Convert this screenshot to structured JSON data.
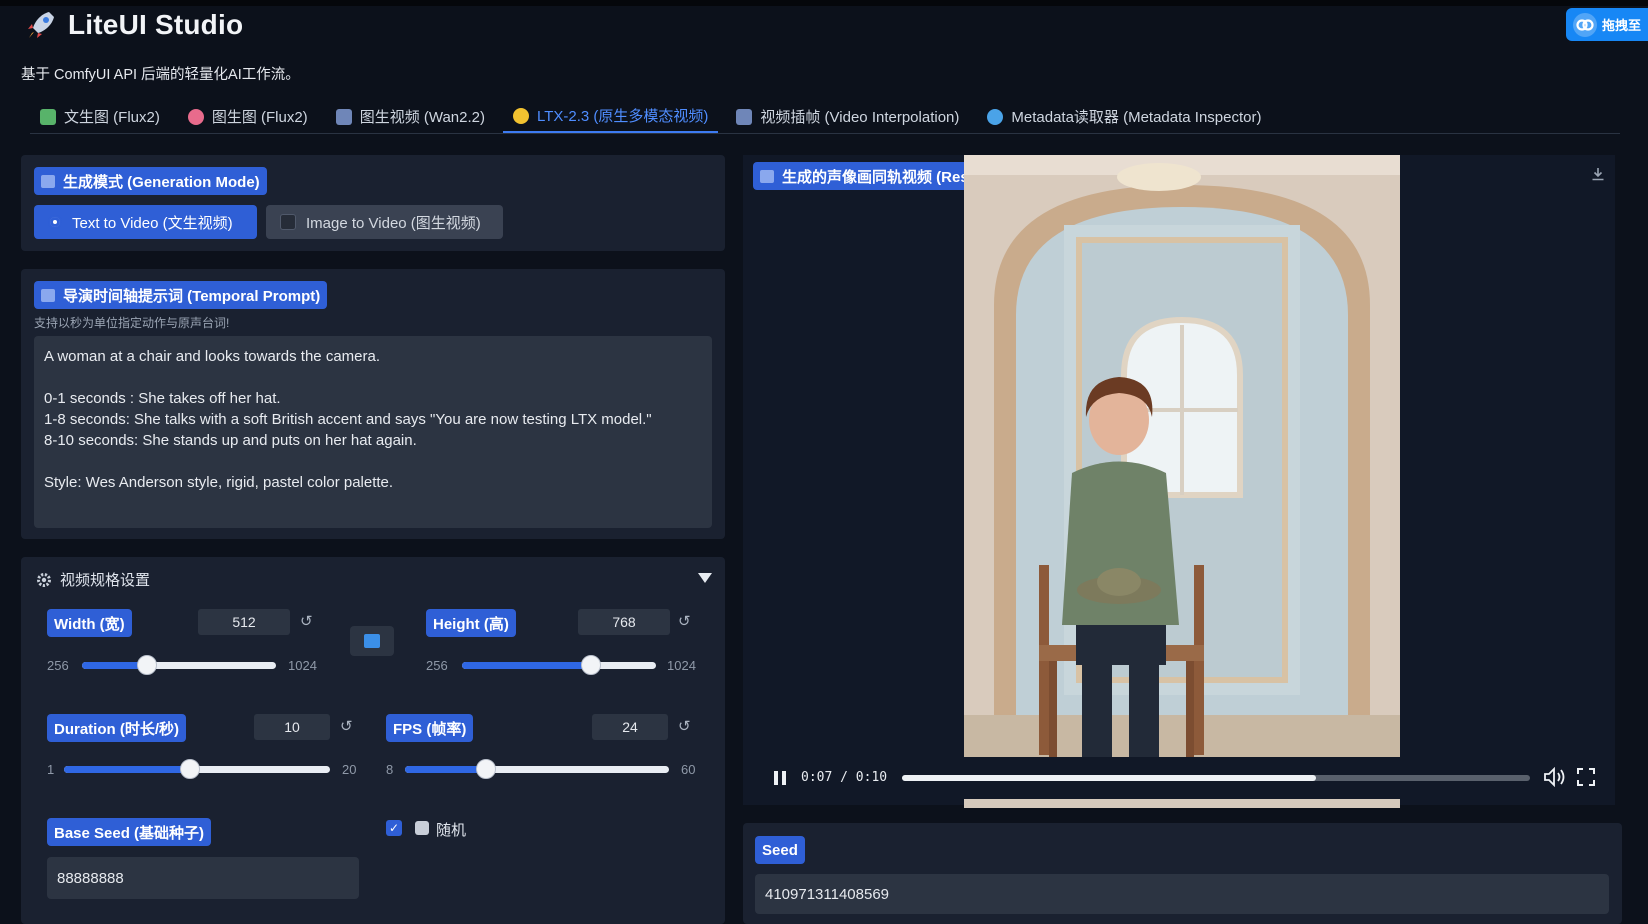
{
  "app": {
    "title": "LiteUI Studio",
    "subtitle": "基于 ComfyUI API 后端的轻量化AI工作流。",
    "corner_badge": "拖拽至"
  },
  "tabs": [
    {
      "label": "文生图 (Flux2)",
      "icon": "image-icon",
      "active": false
    },
    {
      "label": "图生图 (Flux2)",
      "icon": "palette-icon",
      "active": false
    },
    {
      "label": "图生视频 (Wan2.2)",
      "icon": "film-icon",
      "active": false
    },
    {
      "label": "LTX-2.3 (原生多模态视频)",
      "icon": "sparkle-icon",
      "active": true
    },
    {
      "label": "视频插帧 (Video Interpolation)",
      "icon": "film-icon",
      "active": false
    },
    {
      "label": "Metadata读取器 (Metadata Inspector)",
      "icon": "magnifier-icon",
      "active": false
    }
  ],
  "generation_mode": {
    "header": "生成模式 (Generation Mode)",
    "options": [
      {
        "label": "Text to Video (文生视频)",
        "selected": true
      },
      {
        "label": "Image to Video (图生视频)",
        "selected": false
      }
    ]
  },
  "temporal_prompt": {
    "header": "导演时间轴提示词 (Temporal Prompt)",
    "hint": "支持以秒为单位指定动作与原声台词!",
    "text": "A woman at a chair and looks towards the camera.\n\n0-1 seconds : She takes off her hat.\n1-8 seconds: She talks with a soft British accent and says \"You are now testing LTX model.\"\n8-10 seconds: She stands up and puts on her hat again.\n\nStyle: Wes Anderson style, rigid, pastel color palette."
  },
  "video_settings": {
    "header": "视频规格设置",
    "width": {
      "label": "Width (宽)",
      "value": "512",
      "min": "256",
      "max": "1024",
      "num": 512,
      "lo": 256,
      "hi": 1024
    },
    "height": {
      "label": "Height (高)",
      "value": "768",
      "min": "256",
      "max": "1024",
      "num": 768,
      "lo": 256,
      "hi": 1024
    },
    "duration": {
      "label": "Duration (时长/秒)",
      "value": "10",
      "min": "1",
      "max": "20",
      "num": 10,
      "lo": 1,
      "hi": 20
    },
    "fps": {
      "label": "FPS (帧率)",
      "value": "24",
      "min": "8",
      "max": "60",
      "num": 24,
      "lo": 8,
      "hi": 60
    },
    "reset_glyph": "↺",
    "base_seed": {
      "label": "Base Seed (基础种子)",
      "value": "88888888"
    },
    "random": {
      "label": "随机",
      "checked": true
    }
  },
  "result": {
    "header": "生成的声像画同轨视频 (Result)",
    "time": "0:07 / 0:10",
    "progress": 0.66,
    "seed_label": "Seed",
    "seed_value": "410971311408569"
  },
  "colors": {
    "accent": "#2f5fd6",
    "active_tab": "#4f8dff",
    "background": "#0c111b",
    "panel": "#1a2130"
  }
}
